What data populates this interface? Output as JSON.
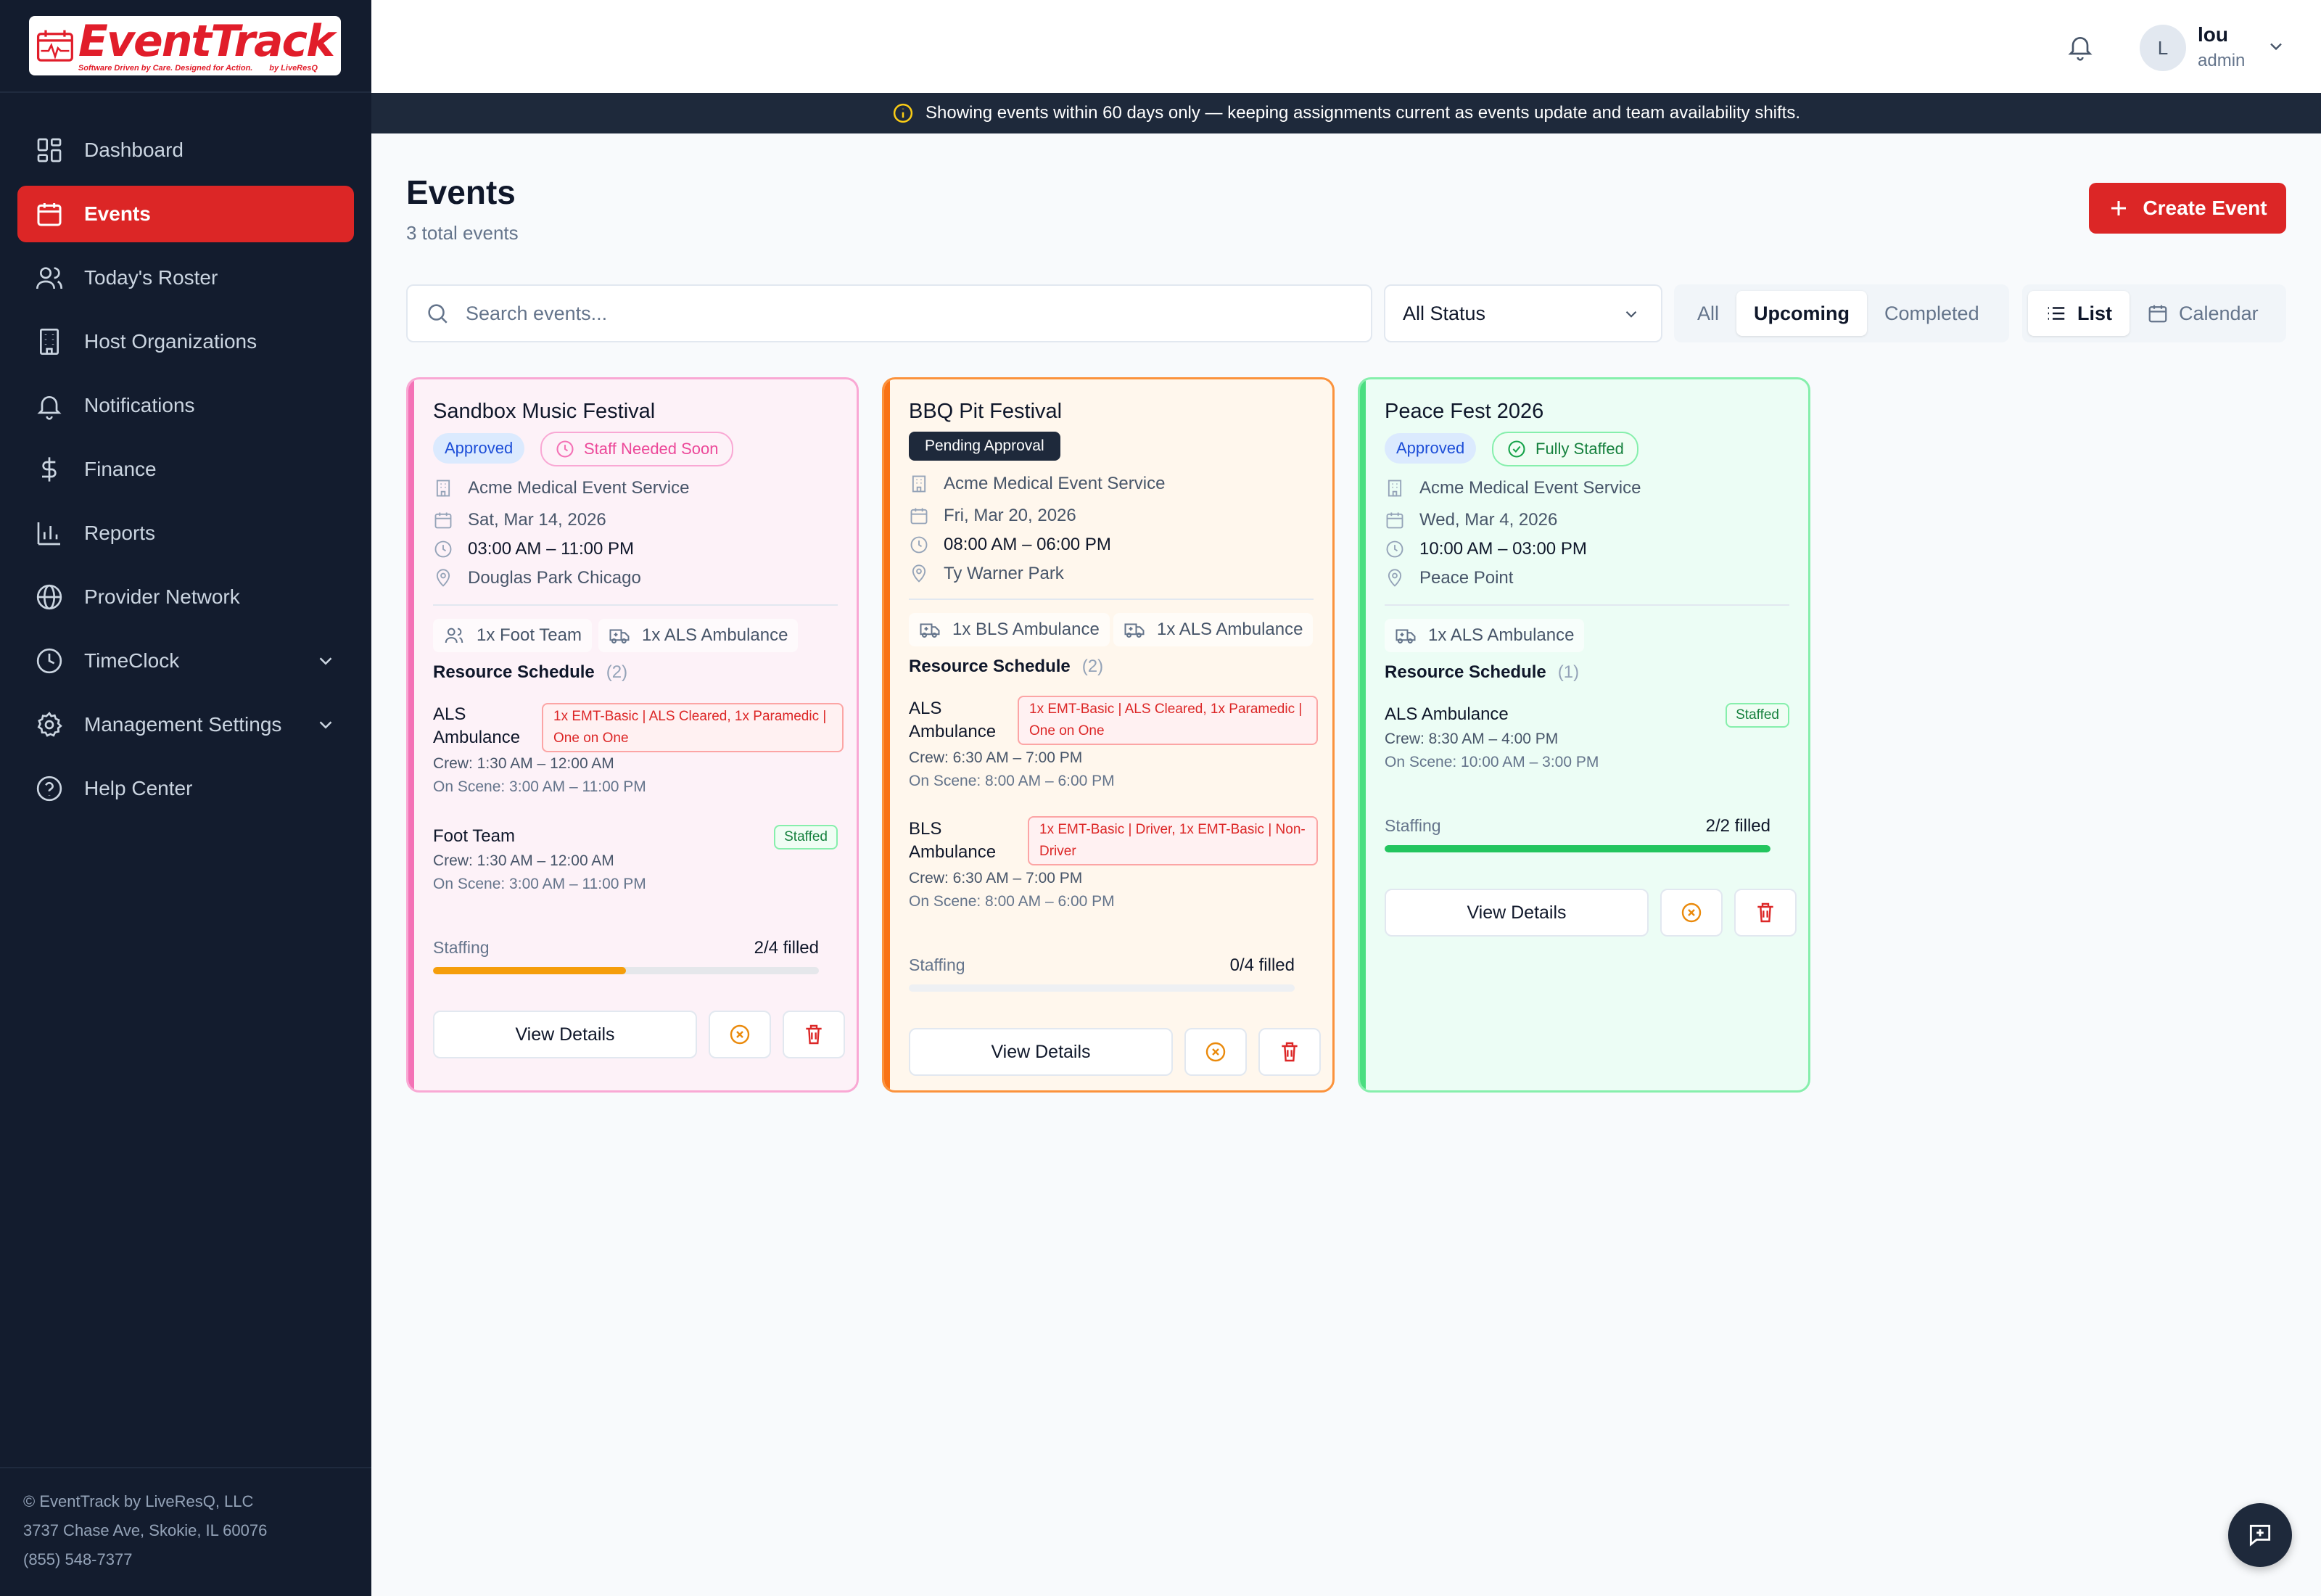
{
  "brand": {
    "name": "EventTrack",
    "tagline": "Software Driven by Care. Designed for Action.",
    "by": "by LiveResQ"
  },
  "sidebar": {
    "items": [
      {
        "label": "Dashboard",
        "icon": "dashboard-icon"
      },
      {
        "label": "Events",
        "icon": "calendar-icon",
        "active": true
      },
      {
        "label": "Today's Roster",
        "icon": "users-icon"
      },
      {
        "label": "Host Organizations",
        "icon": "building-icon"
      },
      {
        "label": "Notifications",
        "icon": "bell-icon"
      },
      {
        "label": "Finance",
        "icon": "dollar-icon"
      },
      {
        "label": "Reports",
        "icon": "bar-chart-icon"
      },
      {
        "label": "Provider Network",
        "icon": "globe-icon"
      },
      {
        "label": "TimeClock",
        "icon": "clock-icon",
        "expandable": true
      },
      {
        "label": "Management Settings",
        "icon": "gear-icon",
        "expandable": true
      },
      {
        "label": "Help Center",
        "icon": "help-icon"
      }
    ],
    "footer": {
      "company": "© EventTrack by LiveResQ, LLC",
      "address": "3737 Chase Ave, Skokie, IL 60076",
      "phone": "(855) 548-7377"
    }
  },
  "topbar": {
    "avatar_initial": "L",
    "user_name": "lou",
    "user_role": "admin"
  },
  "banner": {
    "text": "Showing events within 60 days only — keeping assignments current as events update and team availability shifts."
  },
  "page": {
    "title": "Events",
    "subtitle": "3 total events",
    "create_label": "Create Event"
  },
  "filters": {
    "search_placeholder": "Search events...",
    "status_value": "All Status",
    "range_tabs": [
      "All",
      "Upcoming",
      "Completed"
    ],
    "range_selected": "Upcoming",
    "view_tabs": [
      "List",
      "Calendar"
    ],
    "view_selected": "List"
  },
  "cards": [
    {
      "title": "Sandbox Music Festival",
      "status": "Approved",
      "staffing_badge": "Staff Needed Soon",
      "host": "Acme Medical Event Service",
      "date": "Sat, Mar 14, 2026",
      "time": "03:00 AM – 11:00 PM",
      "location": "Douglas Park Chicago",
      "resources": [
        "1x Foot Team",
        "1x ALS Ambulance"
      ],
      "schedule_label": "Resource Schedule",
      "schedule_count": "(2)",
      "schedule": [
        {
          "name": "ALS Ambulance",
          "need": "1x EMT-Basic | ALS Cleared, 1x Paramedic | One on One",
          "crew": "Crew: 1:30 AM – 12:00 AM",
          "scene": "On Scene: 3:00 AM – 11:00 PM"
        },
        {
          "name": "Foot Team",
          "staffed": "Staffed",
          "crew": "Crew: 1:30 AM – 12:00 AM",
          "scene": "On Scene: 3:00 AM – 11:00 PM"
        }
      ],
      "staffing_label": "Staffing",
      "staffing_value": "2/4 filled",
      "staffing_fraction": 0.5,
      "view_label": "View Details",
      "colors": {
        "border": "#f9a8d4",
        "bg": "#fdf2f8",
        "stripe": "#f472b6",
        "bar": "#f59e0b"
      }
    },
    {
      "title": "BBQ Pit Festival",
      "status": "Pending Approval",
      "host": "Acme Medical Event Service",
      "date": "Fri, Mar 20, 2026",
      "time": "08:00 AM – 06:00 PM",
      "location": "Ty Warner Park",
      "resources": [
        "1x BLS Ambulance",
        "1x ALS Ambulance"
      ],
      "schedule_label": "Resource Schedule",
      "schedule_count": "(2)",
      "schedule": [
        {
          "name": "ALS Ambulance",
          "need": "1x EMT-Basic | ALS Cleared, 1x Paramedic | One on One",
          "crew": "Crew: 6:30 AM – 7:00 PM",
          "scene": "On Scene: 8:00 AM – 6:00 PM"
        },
        {
          "name": "BLS Ambulance",
          "need": "1x EMT-Basic | Driver, 1x EMT-Basic | Non-Driver",
          "crew": "Crew: 6:30 AM – 7:00 PM",
          "scene": "On Scene: 8:00 AM – 6:00 PM"
        }
      ],
      "staffing_label": "Staffing",
      "staffing_value": "0/4 filled",
      "staffing_fraction": 0,
      "view_label": "View Details",
      "colors": {
        "border": "#fb923c",
        "bg": "#fff7ed",
        "stripe": "#f97316",
        "bar": "#f59e0b"
      }
    },
    {
      "title": "Peace Fest 2026",
      "status": "Approved",
      "staffing_badge": "Fully Staffed",
      "host": "Acme Medical Event Service",
      "date": "Wed, Mar 4, 2026",
      "time": "10:00 AM – 03:00 PM",
      "location": "Peace Point",
      "resources": [
        "1x ALS Ambulance"
      ],
      "schedule_label": "Resource Schedule",
      "schedule_count": "(1)",
      "schedule": [
        {
          "name": "ALS Ambulance",
          "staffed": "Staffed",
          "crew": "Crew: 8:30 AM – 4:00 PM",
          "scene": "On Scene: 10:00 AM – 3:00 PM"
        }
      ],
      "staffing_label": "Staffing",
      "staffing_value": "2/2 filled",
      "staffing_fraction": 1,
      "view_label": "View Details",
      "colors": {
        "border": "#86efac",
        "bg": "#ecfdf5",
        "stripe": "#4ade80",
        "bar": "#22c55e"
      }
    }
  ]
}
